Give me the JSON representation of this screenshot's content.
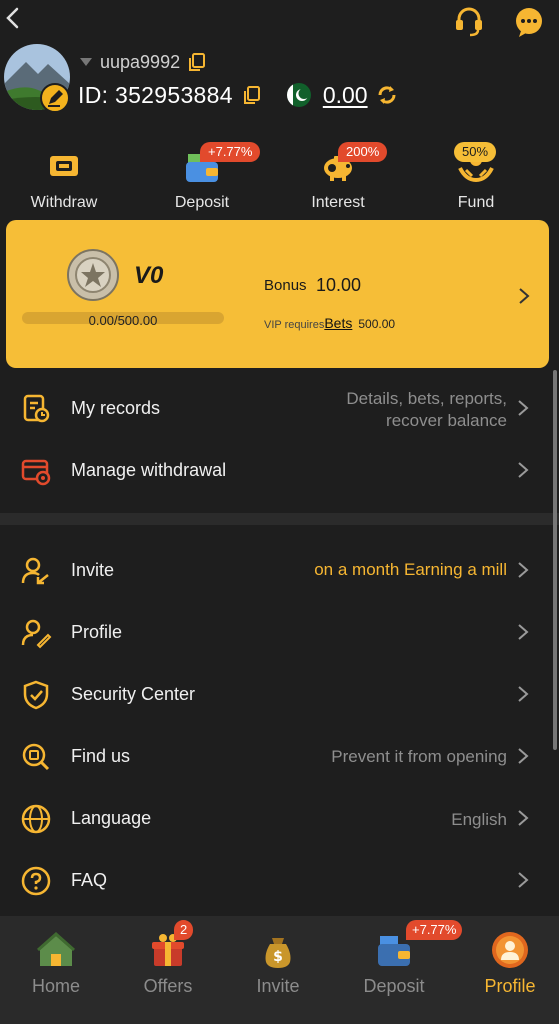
{
  "header": {
    "back_icon": "chevron-left-icon",
    "support_icon": "headset-icon",
    "chat_icon": "chat-bubble-icon"
  },
  "profile": {
    "username": "uupa9992",
    "id_label": "ID: 352953884",
    "balance": "0.00",
    "avatar_icon": "mountain-landscape-avatar",
    "edit_icon": "pencil-icon",
    "flag_icon": "pakistan-flag-icon"
  },
  "quick_actions": [
    {
      "label": "Withdraw",
      "badge": ""
    },
    {
      "label": "Deposit",
      "badge": "+7.77%"
    },
    {
      "label": "Interest",
      "badge": "200%"
    },
    {
      "label": "Fund",
      "badge": "50%"
    }
  ],
  "vip": {
    "level": "V0",
    "progress": "0.00/500.00",
    "progress_fraction": 0,
    "bonus_label": "Bonus",
    "bonus_value": "10.00",
    "requires_text": "VIP requires",
    "bets_link": "Bets",
    "requires_amount": "500.00"
  },
  "menu_top": [
    {
      "label": "My records",
      "value_line1": "Details, bets, reports,",
      "value_line2": "recover balance"
    },
    {
      "label": "Manage withdrawal",
      "value": ""
    }
  ],
  "menu_main": [
    {
      "label": "Invite",
      "value": "on a month  Earning a mill"
    },
    {
      "label": "Profile",
      "value": ""
    },
    {
      "label": "Security Center",
      "value": ""
    },
    {
      "label": "Find us",
      "value": "Prevent it from opening"
    },
    {
      "label": "Language",
      "value": "English"
    },
    {
      "label": "FAQ",
      "value": ""
    }
  ],
  "tabs": [
    {
      "label": "Home",
      "badge": ""
    },
    {
      "label": "Offers",
      "badge": "2"
    },
    {
      "label": "Invite",
      "badge": ""
    },
    {
      "label": "Deposit",
      "badge": "+7.77%"
    },
    {
      "label": "Profile",
      "badge": "",
      "active": true
    }
  ],
  "colors": {
    "background": "#1e1e1e",
    "accent": "#f6be37",
    "badge": "#e24a2c",
    "active_tab": "#f6b632"
  }
}
